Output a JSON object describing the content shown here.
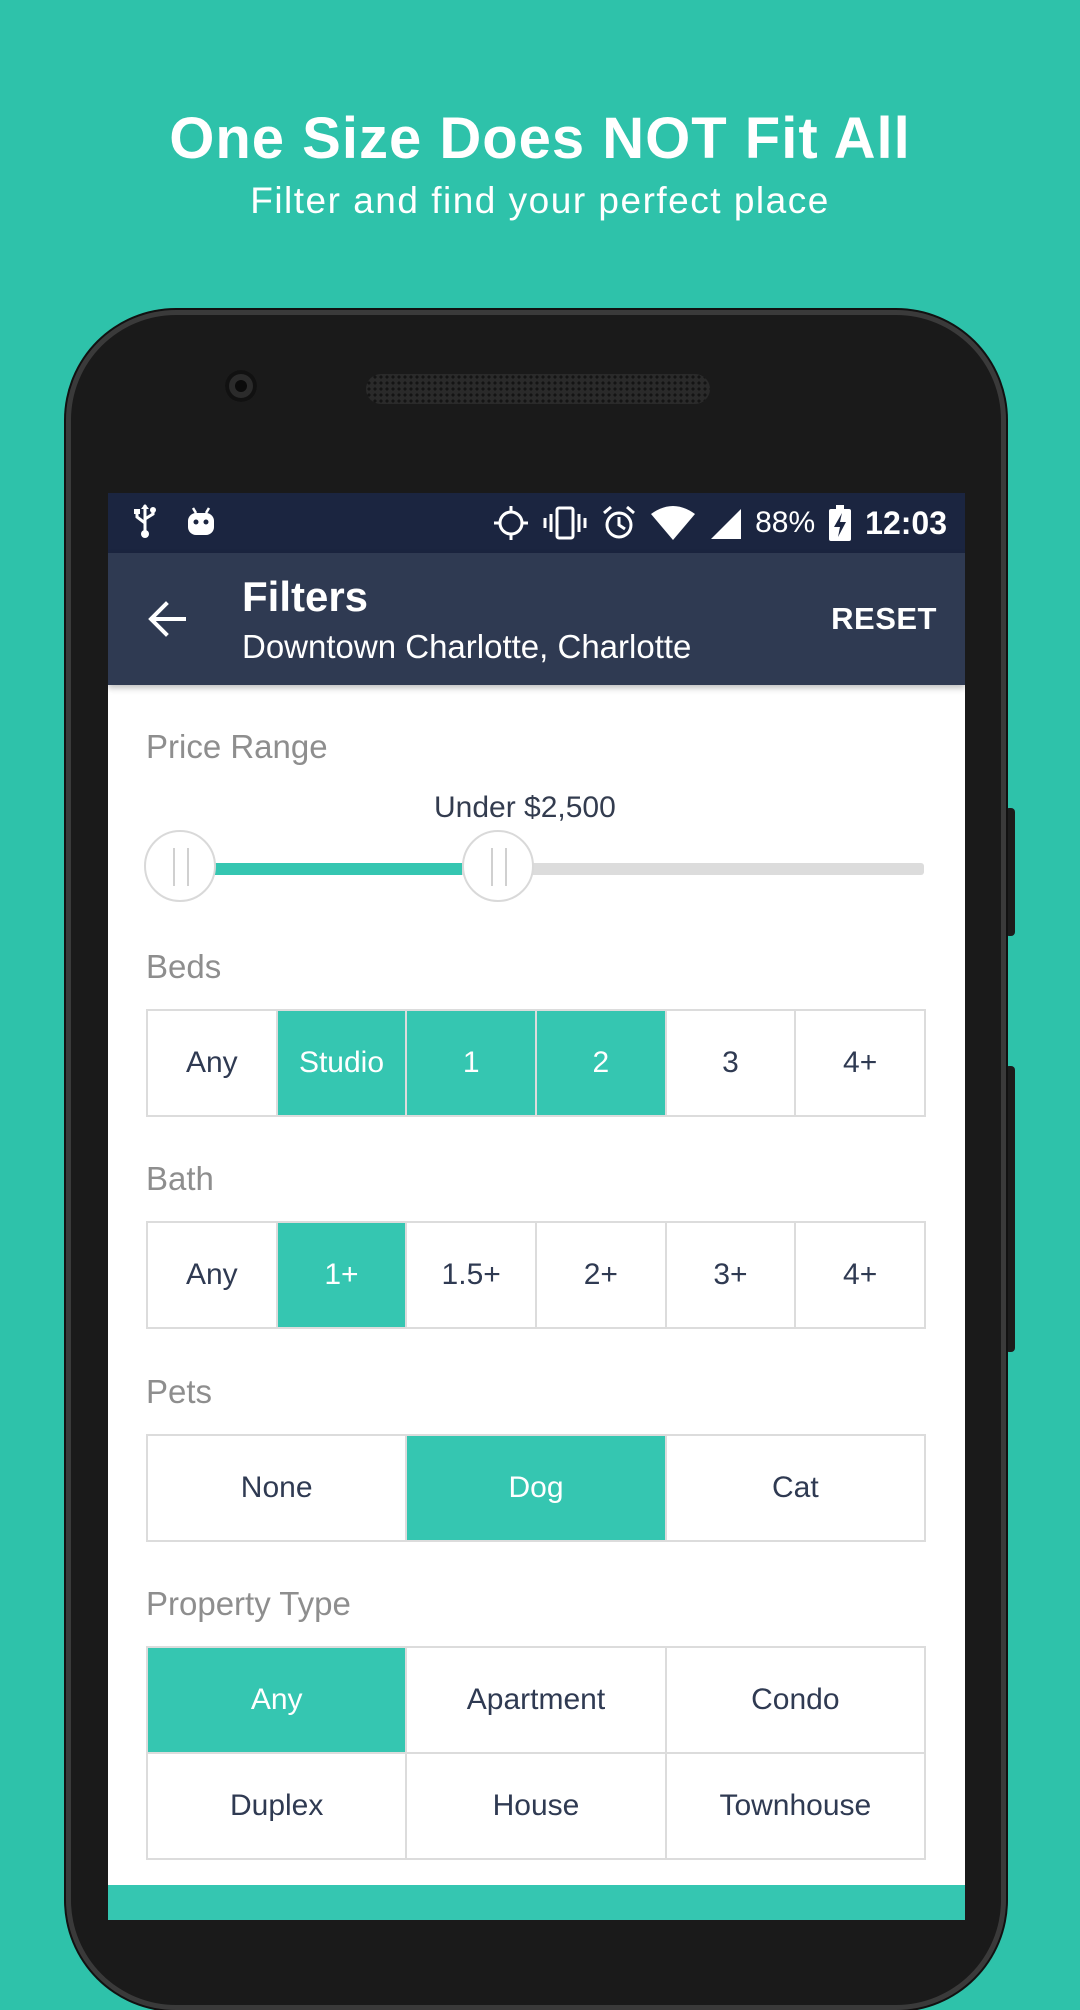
{
  "promo": {
    "title": "One Size Does NOT Fit All",
    "subtitle": "Filter and find your perfect place"
  },
  "status_bar": {
    "left_icons": [
      "usb-icon",
      "android-debug-icon"
    ],
    "right_icons": [
      "location-icon",
      "vibrate-icon",
      "alarm-icon",
      "wifi-icon",
      "signal-icon"
    ],
    "battery": "88%",
    "time": "12:03"
  },
  "toolbar": {
    "title": "Filters",
    "subtitle": "Downtown Charlotte, Charlotte",
    "reset_label": "RESET"
  },
  "price_range": {
    "label": "Price Range",
    "value_text": "Under $2,500",
    "min_fraction": 0.0,
    "max_fraction": 0.38
  },
  "beds": {
    "label": "Beds",
    "options": [
      {
        "label": "Any",
        "selected": false
      },
      {
        "label": "Studio",
        "selected": true
      },
      {
        "label": "1",
        "selected": true
      },
      {
        "label": "2",
        "selected": true
      },
      {
        "label": "3",
        "selected": false
      },
      {
        "label": "4+",
        "selected": false
      }
    ]
  },
  "bath": {
    "label": "Bath",
    "options": [
      {
        "label": "Any",
        "selected": false
      },
      {
        "label": "1+",
        "selected": true
      },
      {
        "label": "1.5+",
        "selected": false
      },
      {
        "label": "2+",
        "selected": false
      },
      {
        "label": "3+",
        "selected": false
      },
      {
        "label": "4+",
        "selected": false
      }
    ]
  },
  "pets": {
    "label": "Pets",
    "options": [
      {
        "label": "None",
        "selected": false
      },
      {
        "label": "Dog",
        "selected": true
      },
      {
        "label": "Cat",
        "selected": false
      }
    ]
  },
  "property_type": {
    "label": "Property Type",
    "options": [
      {
        "label": "Any",
        "selected": true
      },
      {
        "label": "Apartment",
        "selected": false
      },
      {
        "label": "Condo",
        "selected": false
      },
      {
        "label": "Duplex",
        "selected": false
      },
      {
        "label": "House",
        "selected": false
      },
      {
        "label": "Townhouse",
        "selected": false
      }
    ]
  },
  "colors": {
    "background": "#2ec2aa",
    "accent": "#35c6b1",
    "status_bar": "#1b2540",
    "toolbar": "#2f3a52",
    "label_gray": "#8e8e8e"
  }
}
